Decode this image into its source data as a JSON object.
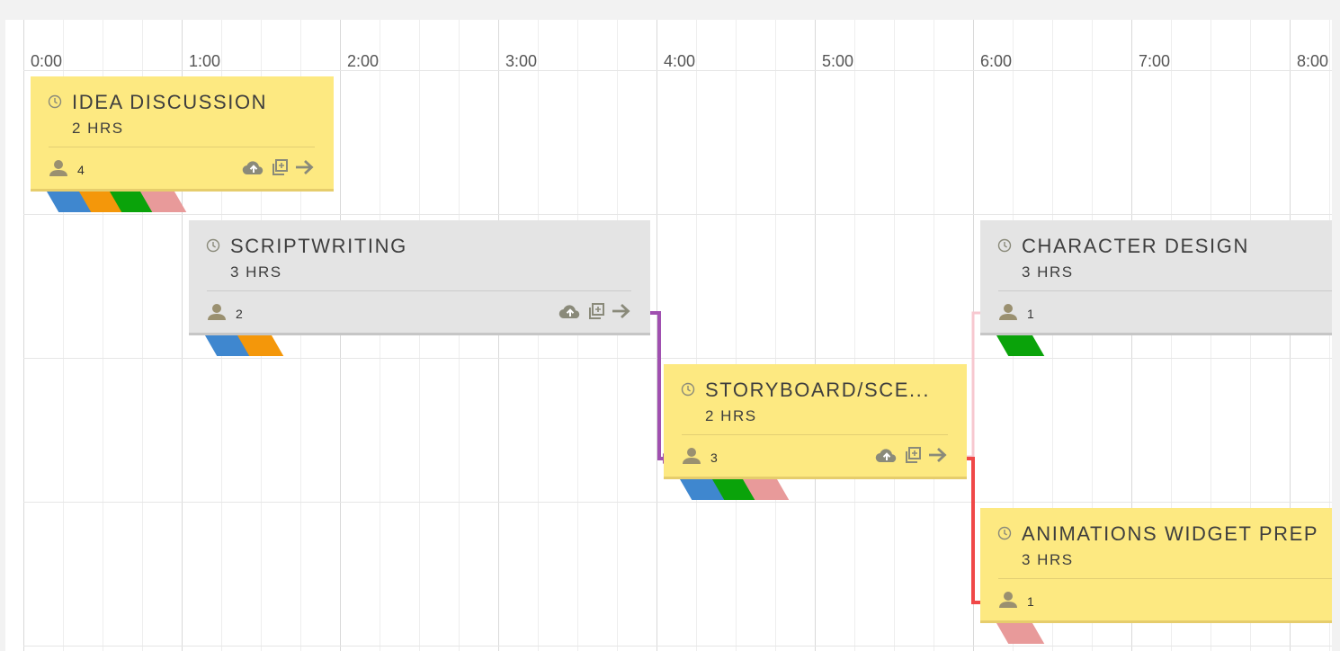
{
  "timeline": {
    "hours": [
      "0:00",
      "1:00",
      "2:00",
      "3:00",
      "4:00",
      "5:00",
      "6:00",
      "7:00",
      "8:00"
    ]
  },
  "tasks": [
    {
      "title": "IDEA DISCUSSION",
      "duration": "2 HRS",
      "members": "4",
      "color": "yellow",
      "tags": [
        "#3f87cf",
        "#f4970a",
        "#0aa30a",
        "#e89a9a"
      ]
    },
    {
      "title": "SCRIPTWRITING",
      "duration": "3 HRS",
      "members": "2",
      "color": "gray",
      "tags": [
        "#3f87cf",
        "#f4970a"
      ]
    },
    {
      "title": "CHARACTER DESIGN",
      "duration": "3 HRS",
      "members": "1",
      "color": "gray",
      "tags": [
        "#0aa30a"
      ]
    },
    {
      "title": "STORYBOARD/SCE...",
      "duration": "2 HRS",
      "members": "3",
      "color": "yellow",
      "tags": [
        "#3f87cf",
        "#0aa30a",
        "#e89a9a"
      ]
    },
    {
      "title": "ANIMATIONS WIDGET PREP",
      "duration": "3 HRS",
      "members": "1",
      "color": "yellow",
      "tags": [
        "#e89a9a"
      ]
    }
  ],
  "icons": {
    "clock": "clock-icon",
    "user": "user-icon",
    "upload": "cloud-upload-icon",
    "duplicate": "duplicate-icon",
    "next": "arrow-right-icon"
  },
  "colors": {
    "connector_purple": "#a050b0",
    "connector_pink": "#f7c8d0",
    "connector_red": "#f04848"
  }
}
